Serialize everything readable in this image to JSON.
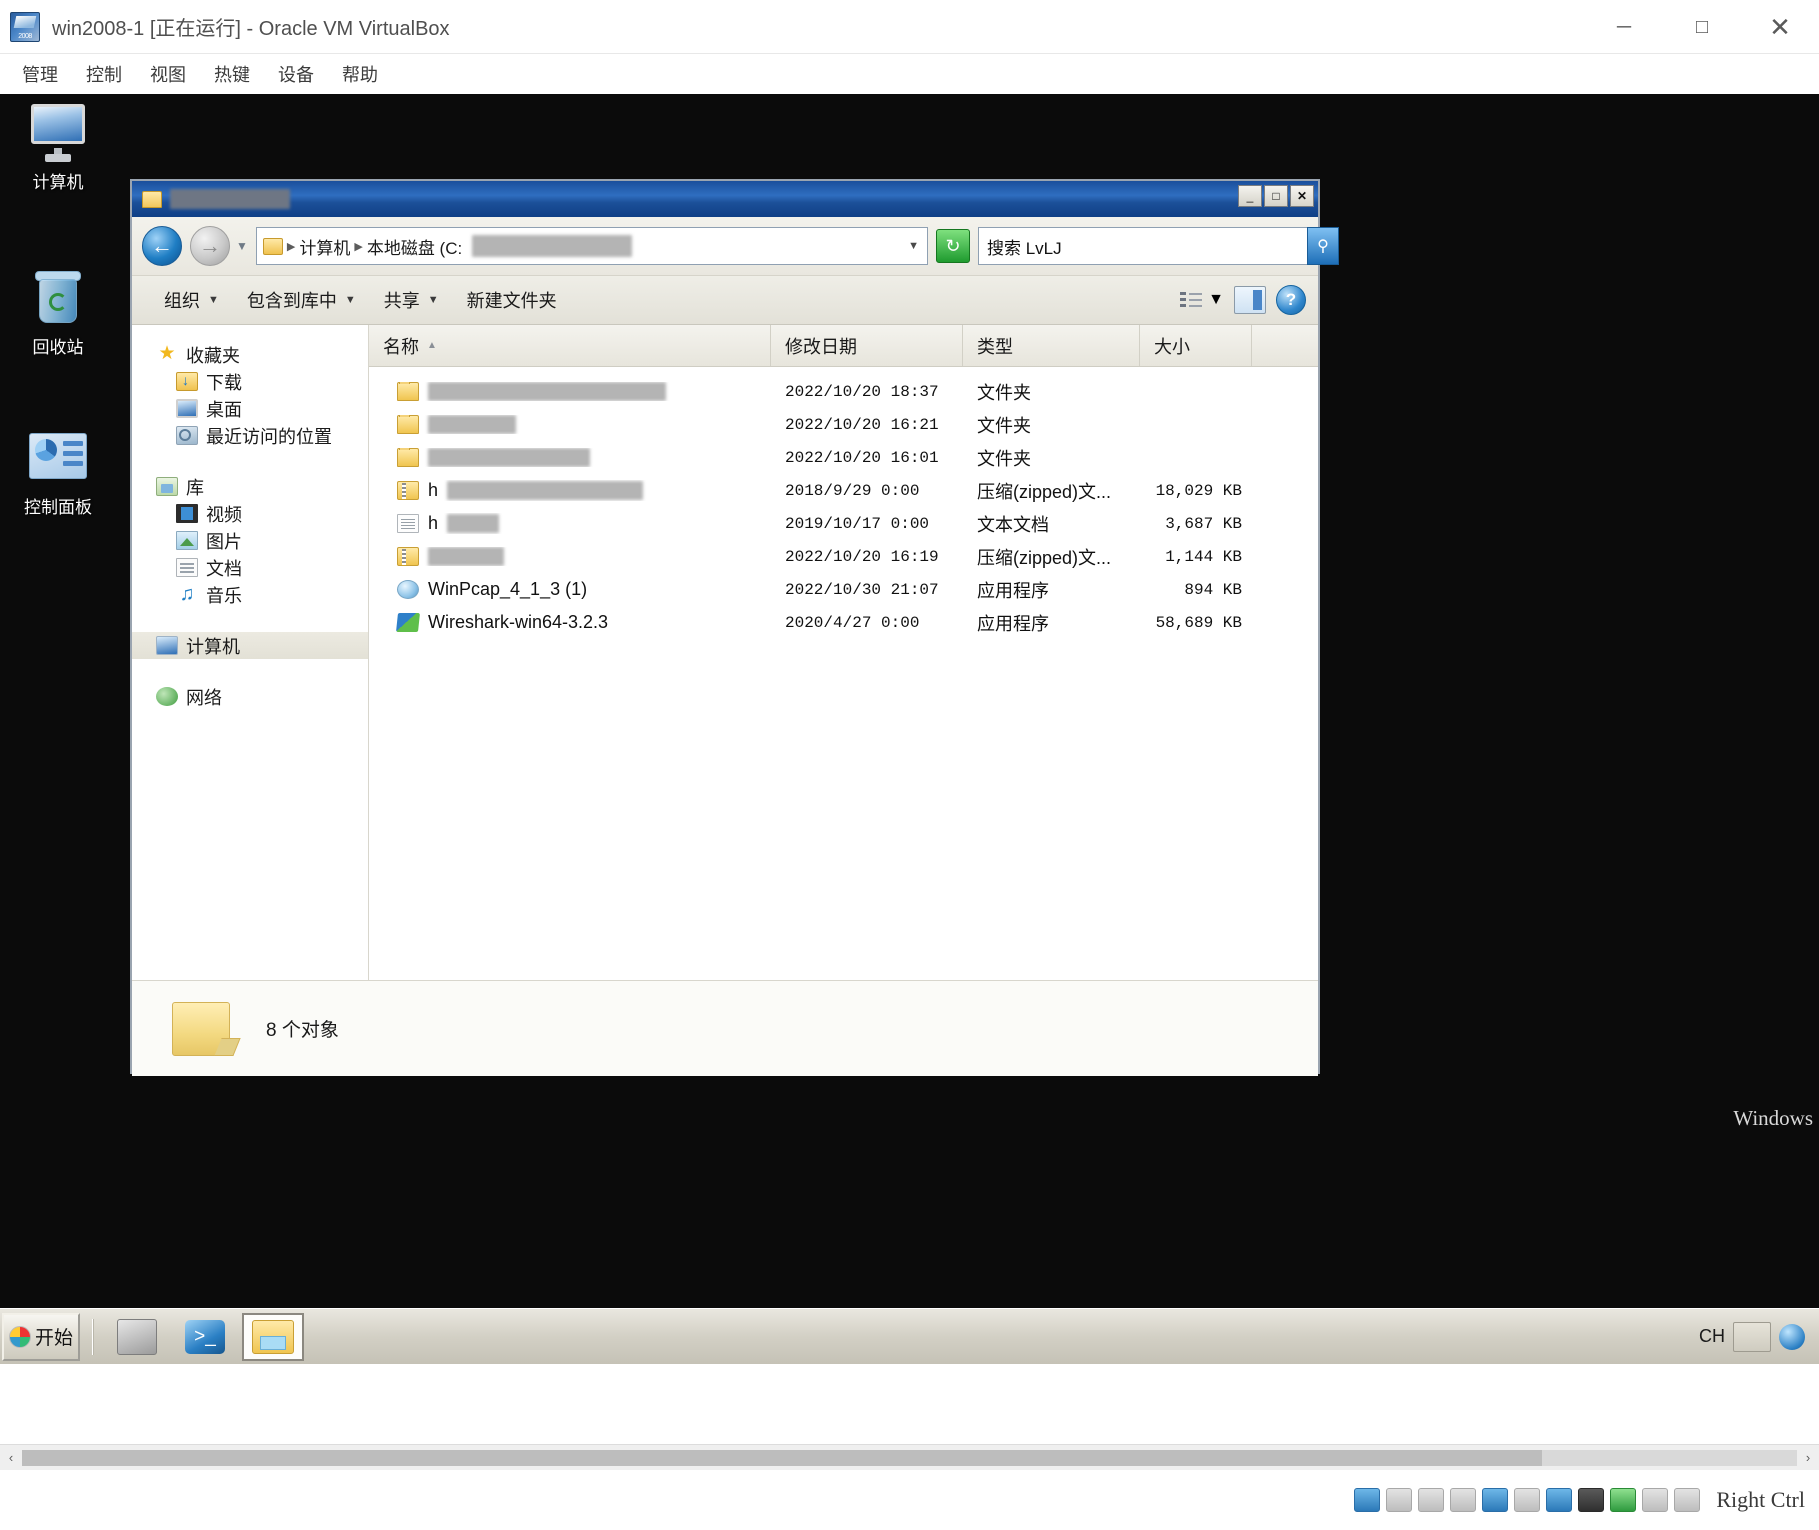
{
  "vbox": {
    "title": "win2008-1 [正在运行] - Oracle VM VirtualBox",
    "window_buttons": {
      "minimize": "─",
      "maximize": "□",
      "close": "✕"
    },
    "menu": [
      "管理",
      "控制",
      "视图",
      "热键",
      "设备",
      "帮助"
    ],
    "statusbar": {
      "hostkey": "Right Ctrl"
    },
    "watermark": "Windows"
  },
  "desktop": {
    "icons": [
      {
        "label": "计算机",
        "glyph": "computer-icon"
      },
      {
        "label": "回收站",
        "glyph": "recycle-bin-icon"
      },
      {
        "label": "控制面板",
        "glyph": "control-panel-icon"
      }
    ]
  },
  "explorer": {
    "title_redacted": true,
    "window_buttons": {
      "minimize": "_",
      "maximize": "□",
      "close": "✕"
    },
    "address": {
      "crumbs": [
        "计算机",
        "本地磁盘 (C:"
      ],
      "crumb_redacted_tail": true,
      "dropdown": "▼",
      "refresh_label": "↻"
    },
    "search": {
      "value": "搜索 LvLJ",
      "placeholder": "搜索 LvLJ",
      "button": "⚲"
    },
    "commandbar": {
      "items": [
        {
          "label": "组织",
          "has_caret": true
        },
        {
          "label": "包含到库中",
          "has_caret": true
        },
        {
          "label": "共享",
          "has_caret": true
        },
        {
          "label": "新建文件夹",
          "has_caret": false
        }
      ],
      "view_caret": "▼",
      "help_label": "?"
    },
    "navpane": {
      "groups": [
        {
          "header": {
            "label": "收藏夹",
            "icon": "star-icon"
          },
          "children": [
            {
              "label": "下载",
              "icon": "downloads-icon"
            },
            {
              "label": "桌面",
              "icon": "desktop-icon"
            },
            {
              "label": "最近访问的位置",
              "icon": "recent-places-icon"
            }
          ]
        },
        {
          "header": {
            "label": "库",
            "icon": "library-icon"
          },
          "children": [
            {
              "label": "视频",
              "icon": "video-icon"
            },
            {
              "label": "图片",
              "icon": "pictures-icon"
            },
            {
              "label": "文档",
              "icon": "documents-icon"
            },
            {
              "label": "音乐",
              "icon": "music-icon"
            }
          ]
        },
        {
          "header": {
            "label": "计算机",
            "icon": "computer-icon",
            "selected": true
          },
          "children": []
        },
        {
          "header": {
            "label": "网络",
            "icon": "network-icon"
          },
          "children": []
        }
      ]
    },
    "columns": [
      {
        "key": "name",
        "label": "名称",
        "sorted": true,
        "sort_arrow": "▲"
      },
      {
        "key": "date",
        "label": "修改日期"
      },
      {
        "key": "type",
        "label": "类型"
      },
      {
        "key": "size",
        "label": "大小"
      }
    ],
    "rows": [
      {
        "name": "",
        "redacted": true,
        "icon": "folder-icon",
        "date": "2022/10/20 18:37",
        "type": "文件夹",
        "size": ""
      },
      {
        "name": "",
        "redacted": true,
        "icon": "folder-icon",
        "date": "2022/10/20 16:21",
        "type": "文件夹",
        "size": ""
      },
      {
        "name": "",
        "redacted": true,
        "icon": "folder-icon",
        "date": "2022/10/20 16:01",
        "type": "文件夹",
        "size": ""
      },
      {
        "name": "h",
        "redacted": true,
        "icon": "zip-icon",
        "date": "2018/9/29 0:00",
        "type": "压缩(zipped)文...",
        "size": "18,029 KB"
      },
      {
        "name": "h",
        "redacted": true,
        "icon": "text-icon",
        "date": "2019/10/17 0:00",
        "type": "文本文档",
        "size": "3,687 KB"
      },
      {
        "name": "",
        "redacted": true,
        "icon": "zip-icon",
        "date": "2022/10/20 16:19",
        "type": "压缩(zipped)文...",
        "size": "1,144 KB"
      },
      {
        "name": "WinPcap_4_1_3 (1)",
        "redacted": false,
        "icon": "application-icon",
        "date": "2022/10/30 21:07",
        "type": "应用程序",
        "size": "894 KB"
      },
      {
        "name": "Wireshark-win64-3.2.3",
        "redacted": false,
        "icon": "wireshark-icon",
        "highlighted": true,
        "date": "2020/4/27 0:00",
        "type": "应用程序",
        "size": "58,689 KB"
      }
    ],
    "status": {
      "count_text": "8 个对象"
    }
  },
  "taskbar": {
    "start_label": "开始",
    "items": [
      {
        "name": "server-manager",
        "active": false
      },
      {
        "name": "powershell",
        "active": false
      },
      {
        "name": "windows-explorer",
        "active": true
      }
    ],
    "tray": {
      "ime": "CH"
    }
  },
  "scrollbar": {
    "left_arrow": "‹",
    "right_arrow": "›"
  },
  "colors": {
    "titlebar_blue": "#1c5099",
    "highlight_green": "#3aa03a",
    "accent_blue": "#2a7fc4",
    "taskbar_grey": "#d3d0c5"
  }
}
